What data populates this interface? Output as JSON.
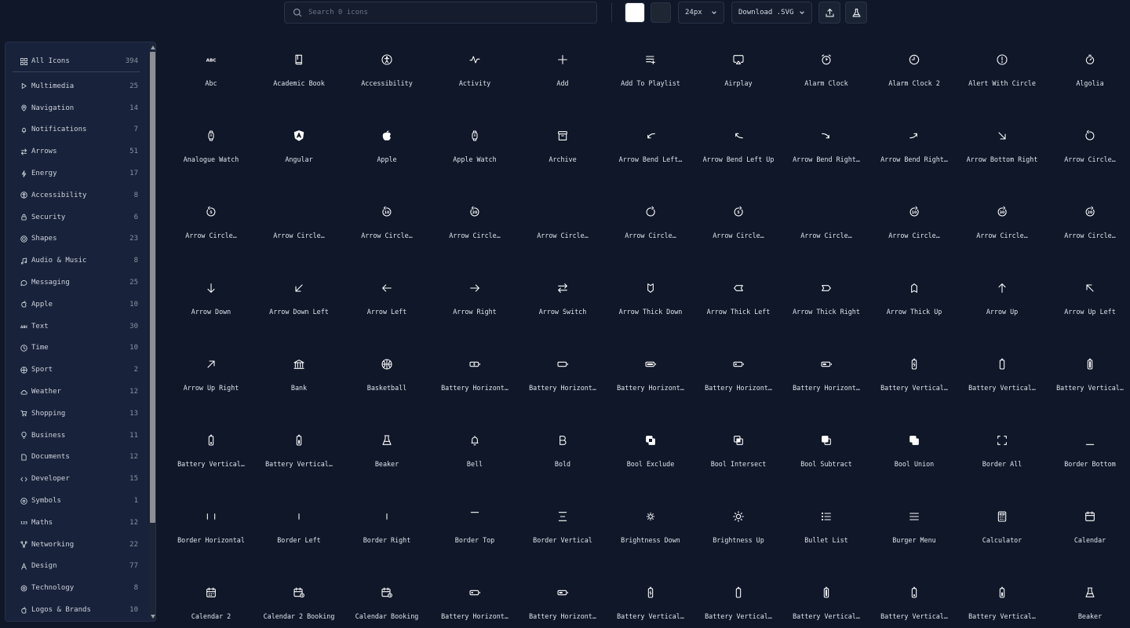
{
  "search": {
    "placeholder": "Search 0 icons"
  },
  "toolbar": {
    "size_label": "24px",
    "download_label": "Download .SVG",
    "upload_icon": "upload-icon",
    "flask_icon": "flask-icon",
    "swatch_white": "#ffffff",
    "swatch_dark": "#1e2633"
  },
  "sidebar": {
    "all": {
      "label": "All Icons",
      "count": "394"
    },
    "items": [
      {
        "label": "Multimedia",
        "count": "25",
        "icon": "play"
      },
      {
        "label": "Navigation",
        "count": "14",
        "icon": "pin"
      },
      {
        "label": "Notifications",
        "count": "7",
        "icon": "bell"
      },
      {
        "label": "Arrows",
        "count": "51",
        "icon": "swap"
      },
      {
        "label": "Energy",
        "count": "17",
        "icon": "bolt"
      },
      {
        "label": "Accessibility",
        "count": "8",
        "icon": "person"
      },
      {
        "label": "Security",
        "count": "6",
        "icon": "lock"
      },
      {
        "label": "Shapes",
        "count": "23",
        "icon": "target"
      },
      {
        "label": "Audio & Music",
        "count": "8",
        "icon": "note"
      },
      {
        "label": "Messaging",
        "count": "25",
        "icon": "chat"
      },
      {
        "label": "Apple",
        "count": "10",
        "icon": "apple"
      },
      {
        "label": "Text",
        "count": "30",
        "icon": "abc"
      },
      {
        "label": "Time",
        "count": "10",
        "icon": "clock"
      },
      {
        "label": "Sport",
        "count": "2",
        "icon": "ball"
      },
      {
        "label": "Weather",
        "count": "12",
        "icon": "cloud"
      },
      {
        "label": "Shopping",
        "count": "13",
        "icon": "cart"
      },
      {
        "label": "Business",
        "count": "11",
        "icon": "bulb"
      },
      {
        "label": "Documents",
        "count": "12",
        "icon": "doc"
      },
      {
        "label": "Developer",
        "count": "15",
        "icon": "code"
      },
      {
        "label": "Symbols",
        "count": "1",
        "icon": "at"
      },
      {
        "label": "Maths",
        "count": "12",
        "icon": "num"
      },
      {
        "label": "Networking",
        "count": "22",
        "icon": "net"
      },
      {
        "label": "Design",
        "count": "77",
        "icon": "pen"
      },
      {
        "label": "Technology",
        "count": "8",
        "icon": "gear"
      },
      {
        "label": "Logos & Brands",
        "count": "10",
        "icon": "apple"
      }
    ]
  },
  "icons": [
    {
      "n": "Abc",
      "g": "abc"
    },
    {
      "n": "Academic Book",
      "g": "book"
    },
    {
      "n": "Accessibility",
      "g": "access"
    },
    {
      "n": "Activity",
      "g": "activity"
    },
    {
      "n": "Add",
      "g": "plus"
    },
    {
      "n": "Add To Playlist",
      "g": "playlist"
    },
    {
      "n": "Airplay",
      "g": "airplay"
    },
    {
      "n": "Alarm Clock",
      "g": "alarm"
    },
    {
      "n": "Alarm Clock 2",
      "g": "alarm2"
    },
    {
      "n": "Alert With Circle",
      "g": "alert"
    },
    {
      "n": "Algolia",
      "g": "algolia"
    },
    {
      "n": "Analogue Watch",
      "g": "watch"
    },
    {
      "n": "Angular",
      "g": "angular"
    },
    {
      "n": "Apple",
      "g": "apple"
    },
    {
      "n": "Apple Watch",
      "g": "watch"
    },
    {
      "n": "Archive",
      "g": "archive"
    },
    {
      "n": "Arrow Bend Left…",
      "g": "bend-ld"
    },
    {
      "n": "Arrow Bend Left Up",
      "g": "bend-lu"
    },
    {
      "n": "Arrow Bend Right…",
      "g": "bend-rd"
    },
    {
      "n": "Arrow Bend Right…",
      "g": "bend-ru"
    },
    {
      "n": "Arrow Bottom Right",
      "g": "arrow-br"
    },
    {
      "n": "Arrow Circle…",
      "g": "circ-l"
    },
    {
      "n": "Arrow Circle…",
      "g": "circ-5"
    },
    {
      "n": "Arrow Circle…",
      "g": "none"
    },
    {
      "n": "Arrow Circle…",
      "g": "circ-10"
    },
    {
      "n": "Arrow Circle…",
      "g": "circ-20"
    },
    {
      "n": "Arrow Circle…",
      "g": "none"
    },
    {
      "n": "Arrow Circle…",
      "g": "circ-r"
    },
    {
      "n": "Arrow Circle…",
      "g": "circ-5r"
    },
    {
      "n": "Arrow Circle…",
      "g": "none"
    },
    {
      "n": "Arrow Circle…",
      "g": "circ-10r"
    },
    {
      "n": "Arrow Circle…",
      "g": "circ-30r"
    },
    {
      "n": "Arrow Circle…",
      "g": "circ-20r"
    },
    {
      "n": "Arrow Down",
      "g": "down"
    },
    {
      "n": "Arrow Down Left",
      "g": "down-left"
    },
    {
      "n": "Arrow Left",
      "g": "left"
    },
    {
      "n": "Arrow Right",
      "g": "right"
    },
    {
      "n": "Arrow Switch",
      "g": "switch"
    },
    {
      "n": "Arrow Thick Down",
      "g": "thick-d"
    },
    {
      "n": "Arrow Thick Left",
      "g": "thick-l"
    },
    {
      "n": "Arrow Thick Right",
      "g": "thick-r"
    },
    {
      "n": "Arrow Thick Up",
      "g": "thick-u"
    },
    {
      "n": "Arrow Up",
      "g": "up"
    },
    {
      "n": "Arrow Up Left",
      "g": "up-left"
    },
    {
      "n": "Arrow Up Right",
      "g": "up-right"
    },
    {
      "n": "Bank",
      "g": "bank"
    },
    {
      "n": "Basketball",
      "g": "basketball"
    },
    {
      "n": "Battery Horizont…",
      "g": "bh-charge"
    },
    {
      "n": "Battery Horizont…",
      "g": "bh-empty"
    },
    {
      "n": "Battery Horizont…",
      "g": "bh-full"
    },
    {
      "n": "Battery Horizont…",
      "g": "bh-low"
    },
    {
      "n": "Battery Horizont…",
      "g": "bh-mid"
    },
    {
      "n": "Battery Vertical…",
      "g": "bv-charge"
    },
    {
      "n": "Battery Vertical…",
      "g": "bv-empty"
    },
    {
      "n": "Battery Vertical…",
      "g": "bv-full"
    },
    {
      "n": "Battery Vertical…",
      "g": "bv-low"
    },
    {
      "n": "Battery Vertical…",
      "g": "bv-mid"
    },
    {
      "n": "Beaker",
      "g": "beaker"
    },
    {
      "n": "Bell",
      "g": "bell"
    },
    {
      "n": "Bold",
      "g": "bold"
    },
    {
      "n": "Bool Exclude",
      "g": "bool-ex"
    },
    {
      "n": "Bool Intersect",
      "g": "bool-in"
    },
    {
      "n": "Bool Subtract",
      "g": "bool-sub"
    },
    {
      "n": "Bool Union",
      "g": "bool-un"
    },
    {
      "n": "Border All",
      "g": "border-all"
    },
    {
      "n": "Border Bottom",
      "g": "border-b"
    },
    {
      "n": "Border Horizontal",
      "g": "border-h"
    },
    {
      "n": "Border Left",
      "g": "border-l"
    },
    {
      "n": "Border Right",
      "g": "border-r"
    },
    {
      "n": "Border Top",
      "g": "border-t"
    },
    {
      "n": "Border Vertical",
      "g": "border-v"
    },
    {
      "n": "Brightness Down",
      "g": "sun-s"
    },
    {
      "n": "Brightness Up",
      "g": "sun-l"
    },
    {
      "n": "Bullet List",
      "g": "bullets"
    },
    {
      "n": "Burger Menu",
      "g": "burger"
    },
    {
      "n": "Calculator",
      "g": "calculator"
    },
    {
      "n": "Calendar",
      "g": "calendar"
    },
    {
      "n": "Calendar 2",
      "g": "calendar2"
    },
    {
      "n": "Calendar 2 Booking",
      "g": "cal-book"
    },
    {
      "n": "Calendar Booking",
      "g": "cal-book"
    },
    {
      "n": "Battery Horizont…",
      "g": "bh-low"
    },
    {
      "n": "Battery Horizont…",
      "g": "bh-mid"
    },
    {
      "n": "Battery Vertical…",
      "g": "bv-charge"
    },
    {
      "n": "Battery Vertical…",
      "g": "bv-empty"
    },
    {
      "n": "Battery Vertical…",
      "g": "bv-full"
    },
    {
      "n": "Battery Vertical…",
      "g": "bv-low"
    },
    {
      "n": "Battery Vertical…",
      "g": "bv-mid"
    },
    {
      "n": "Beaker",
      "g": "beaker"
    }
  ]
}
